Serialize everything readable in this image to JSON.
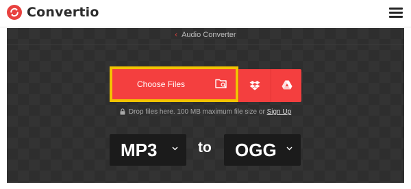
{
  "header": {
    "brand": "Convertio",
    "brand_color": "#e8413f",
    "menu_icon": "hamburger-menu-icon"
  },
  "hero": {
    "breadcrumb_label": "Audio Converter",
    "breadcrumb_icon": "chevron-left-icon",
    "upload": {
      "choose_files_label": "Choose Files",
      "choose_files_icon": "folder-search-icon",
      "dropbox_icon": "dropbox-icon",
      "gdrive_icon": "google-drive-icon",
      "accent": "#f43f3f",
      "highlight": "#f2c400"
    },
    "drop_note": {
      "text": "Drop files here. 100 MB maximum file size or",
      "signup_label": "Sign Up",
      "icon": "lock-icon"
    },
    "format": {
      "from": "MP3",
      "to_label": "to",
      "to": "OGG",
      "dropdown_icon": "chevron-down-icon"
    }
  }
}
